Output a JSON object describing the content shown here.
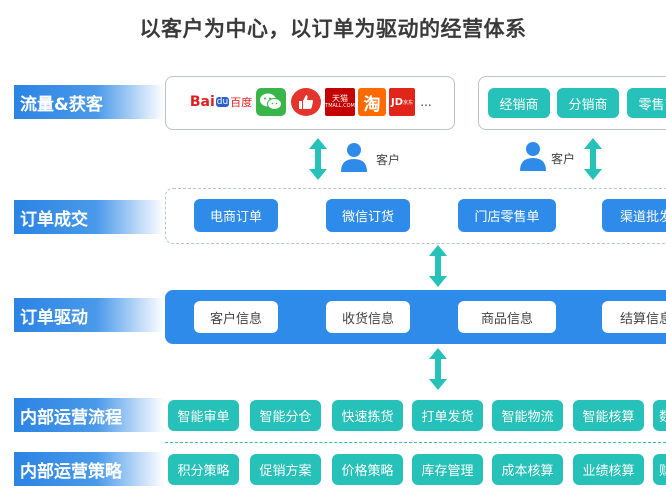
{
  "title": "以客户为中心，以订单为驱动的经营体系",
  "rows": {
    "traffic": "流量&获客",
    "order_deal": "订单成交",
    "order_drive": "订单驱动",
    "internal_process": "内部运营流程",
    "internal_strategy": "内部运营策略"
  },
  "traffic_logos": {
    "baidu_text": "Bai",
    "baidu_paw": "du",
    "baidu_cn": "百度",
    "tmall_top": "天猫",
    "tmall_bottom": "TMALL.COM",
    "taobao": "淘",
    "jd": "JD",
    "jd_small": "京东",
    "more": "..."
  },
  "channels": [
    "经销商",
    "分销商",
    "零售商"
  ],
  "customer_label": "客户",
  "order_types": [
    "电商订单",
    "微信订货",
    "门店零售单",
    "渠道批发"
  ],
  "order_info": [
    "客户信息",
    "收货信息",
    "商品信息",
    "结算信息"
  ],
  "process": [
    "智能审单",
    "智能分仓",
    "快速拣货",
    "打单发货",
    "智能物流",
    "智能核算",
    "数"
  ],
  "strategy": [
    "积分策略",
    "促销方案",
    "价格策略",
    "库存管理",
    "成本核算",
    "业绩核算",
    "财"
  ],
  "colors": {
    "blue": "#2e8bea",
    "teal": "#26c1b8",
    "label_blue": "#2b83e4"
  }
}
